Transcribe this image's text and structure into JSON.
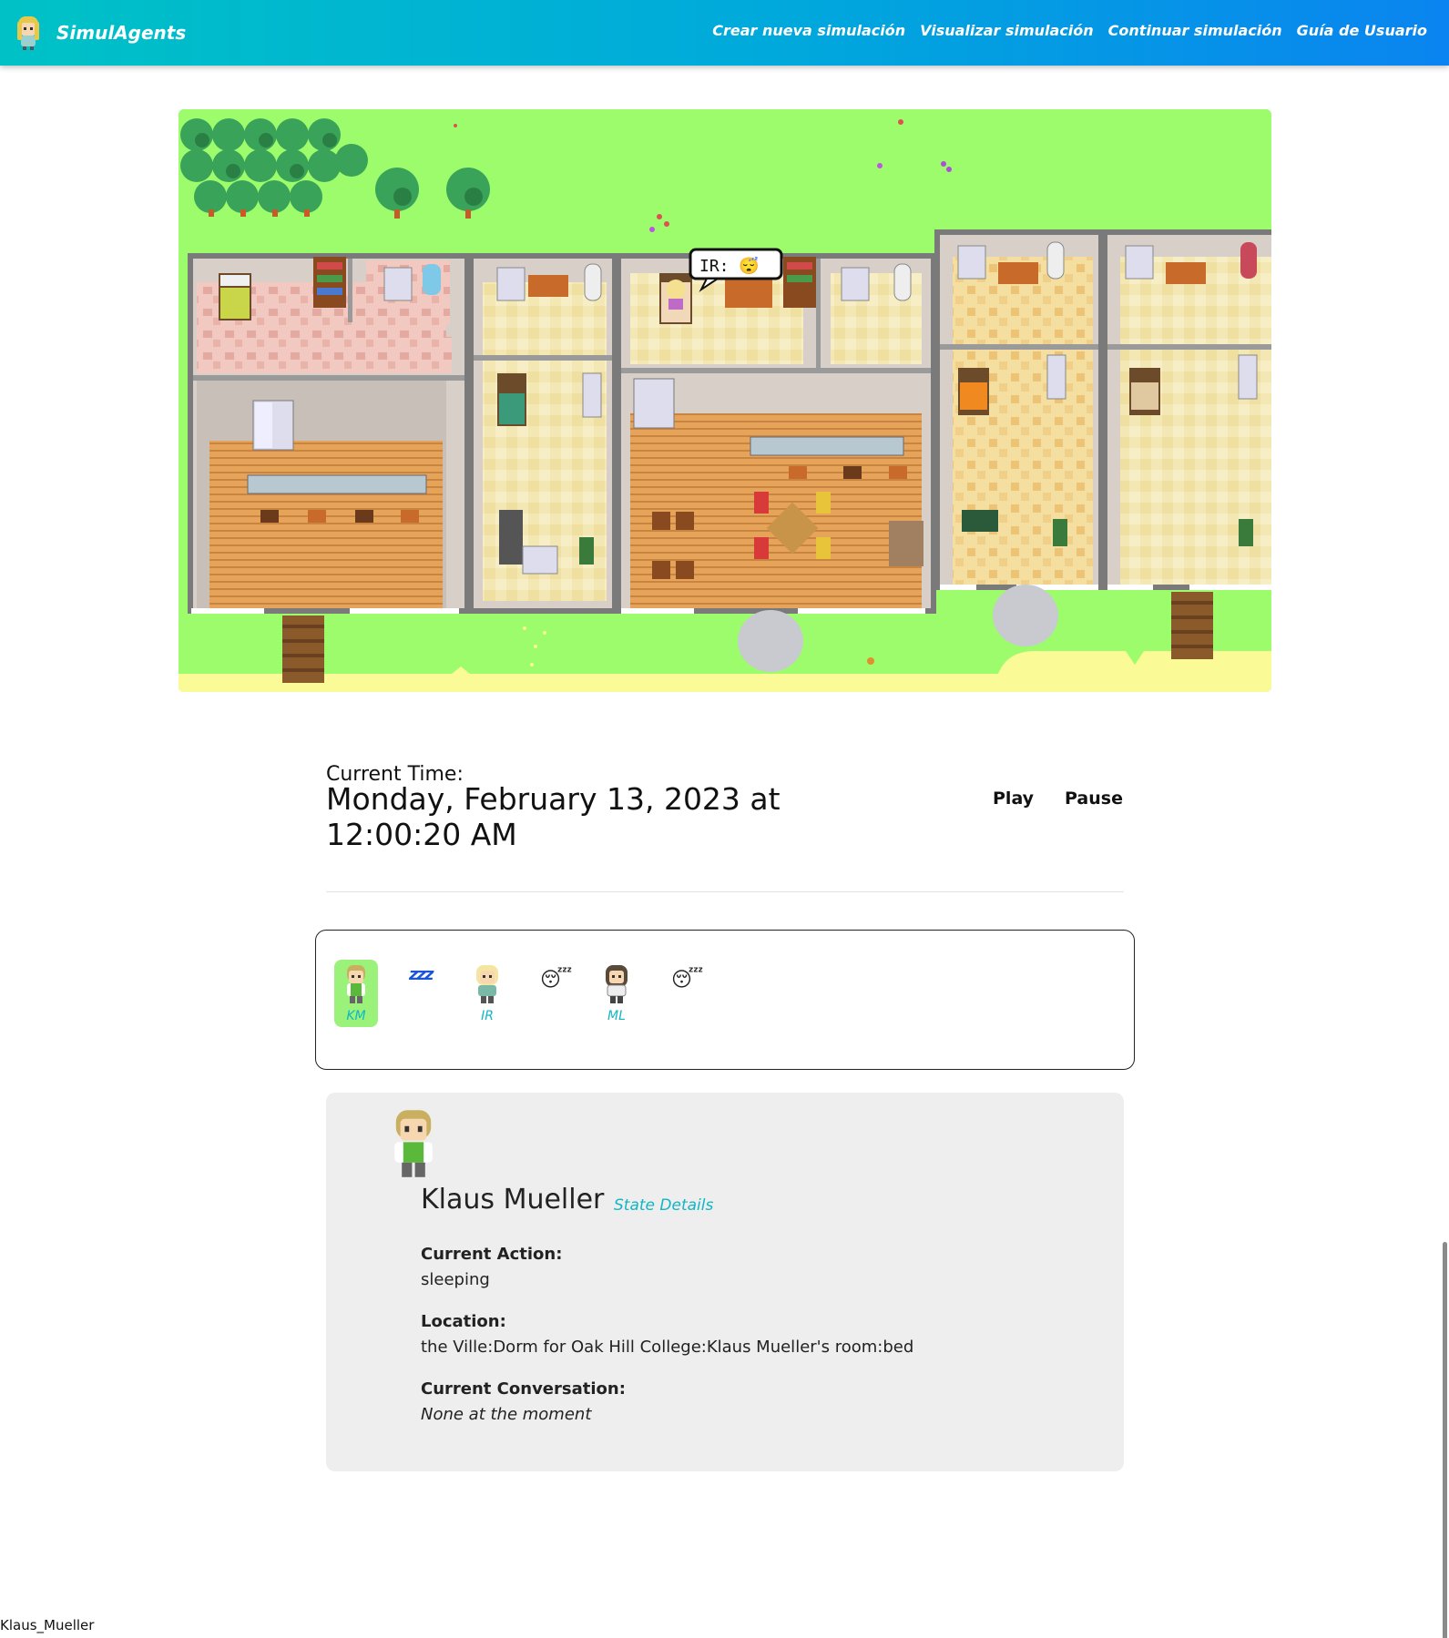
{
  "nav": {
    "brand": "SimulAgents",
    "links": [
      "Crear nueva simulación",
      "Visualizar simulación",
      "Continuar simulación",
      "Guía de Usuario"
    ]
  },
  "map": {
    "speech_bubble": "IR: 😴"
  },
  "time": {
    "label": "Current Time:",
    "value": "Monday, February 13, 2023 at 12:00:20 AM"
  },
  "controls": {
    "play": "Play",
    "pause": "Pause"
  },
  "personas": [
    {
      "initials": "KM",
      "status": "zzz",
      "active": true
    },
    {
      "initials": "IR",
      "status": "😴",
      "active": false
    },
    {
      "initials": "ML",
      "status": "😴",
      "active": false
    }
  ],
  "detail": {
    "name": "Klaus Mueller",
    "state_link": "State Details",
    "current_action_label": "Current Action:",
    "current_action": "sleeping",
    "location_label": "Location:",
    "location": "the Ville:Dorm for Oak Hill College:Klaus Mueller's room:bed",
    "conversation_label": "Current Conversation:",
    "conversation": "None at the moment"
  },
  "footer_label": "Klaus_Mueller",
  "colors": {
    "nav_start": "#00c2c6",
    "nav_end": "#0a84f0",
    "accent_text": "#12b5c4",
    "active_persona_bg": "#9bf27a",
    "grass": "#9cfc6c",
    "card_bg": "#eeeeee"
  }
}
